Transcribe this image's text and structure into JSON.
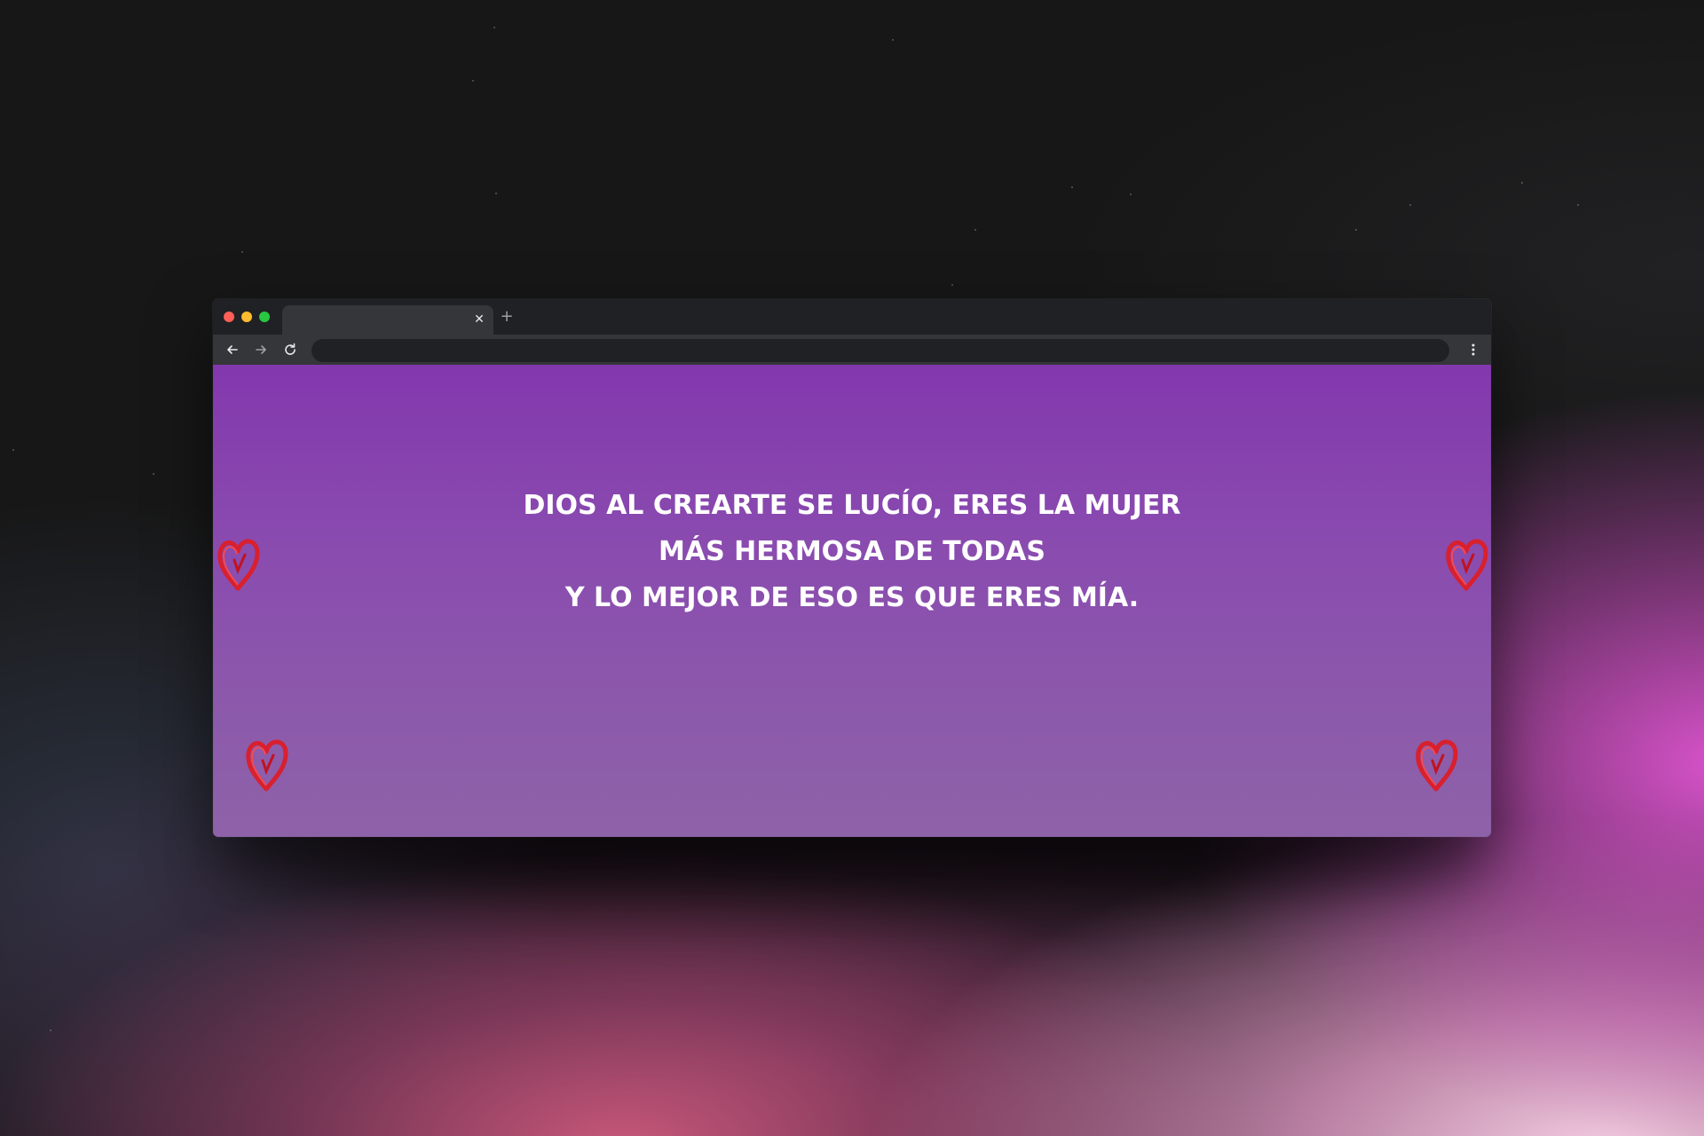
{
  "browser": {
    "tab": {
      "title": "",
      "close_icon": "close-icon"
    },
    "new_tab_icon": "plus-icon",
    "toolbar": {
      "back_icon": "arrow-left-icon",
      "forward_icon": "arrow-right-icon",
      "reload_icon": "reload-icon",
      "address_value": "",
      "menu_icon": "kebab-menu-icon"
    },
    "traffic_lights": {
      "close": "#ff5f57",
      "minimize": "#febc2e",
      "maximize": "#28c840"
    }
  },
  "page": {
    "background_colors": [
      "#8338ae",
      "#8e62a8"
    ],
    "message_lines": [
      "DIOS AL CREARTE SE LUCÍO, ERES LA MUJER",
      "MÁS HERMOSA DE TODAS",
      "Y LO MEJOR DE ESO ES QUE ERES MÍA."
    ],
    "decorations": {
      "heart_icon": "heart-icon",
      "heart_color": "#d8202e",
      "count": 4
    }
  }
}
